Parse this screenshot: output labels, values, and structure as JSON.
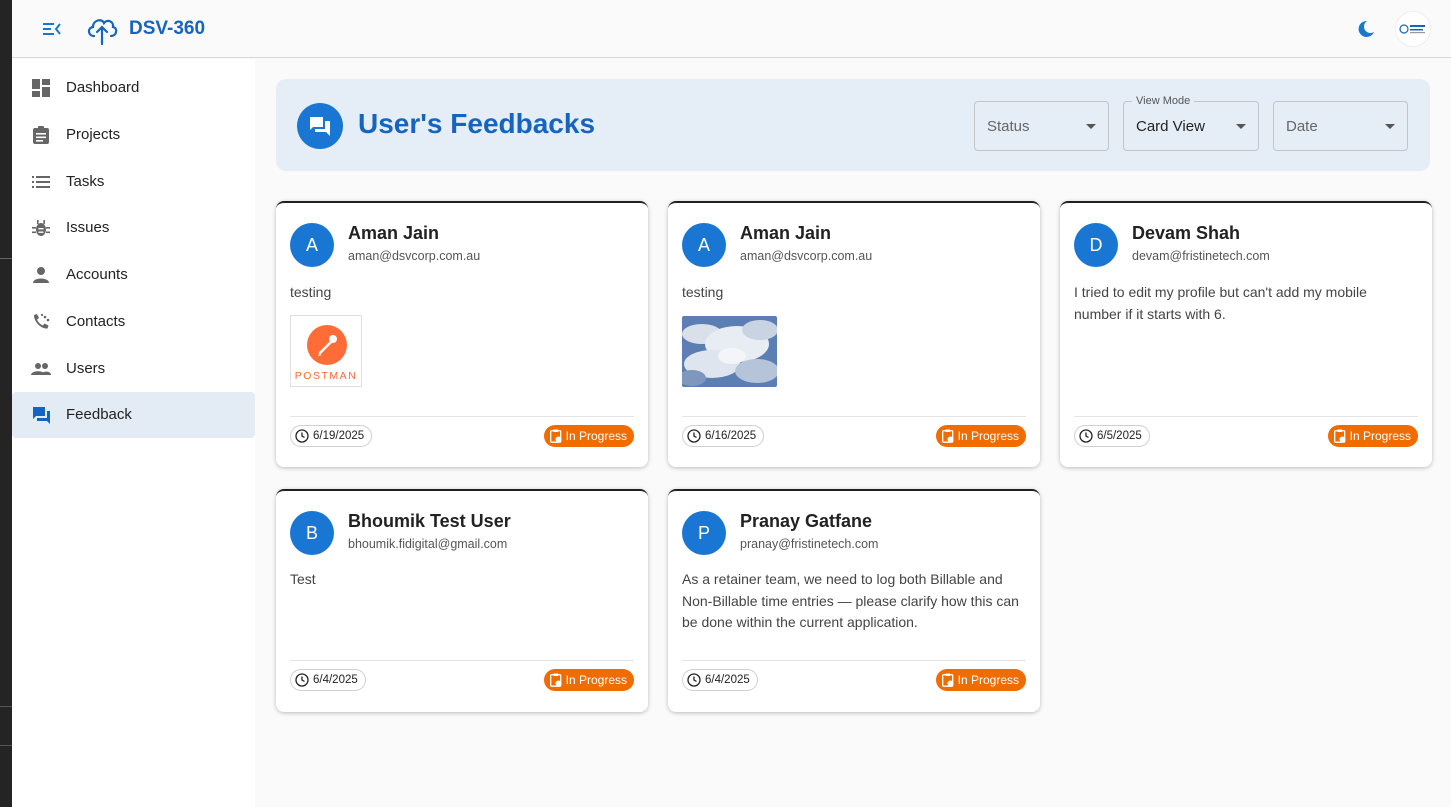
{
  "app": {
    "title": "DSV-360"
  },
  "sidebar": {
    "items": [
      {
        "label": "Dashboard",
        "icon": "dashboard-icon",
        "active": false
      },
      {
        "label": "Projects",
        "icon": "clipboard-icon",
        "active": false
      },
      {
        "label": "Tasks",
        "icon": "list-icon",
        "active": false
      },
      {
        "label": "Issues",
        "icon": "bug-icon",
        "active": false
      },
      {
        "label": "Accounts",
        "icon": "person-icon",
        "active": false
      },
      {
        "label": "Contacts",
        "icon": "contacts-icon",
        "active": false
      },
      {
        "label": "Users",
        "icon": "people-icon",
        "active": false
      },
      {
        "label": "Feedback",
        "icon": "feedback-icon",
        "active": true
      }
    ]
  },
  "header": {
    "title": "User's Feedbacks",
    "filters": {
      "status": {
        "placeholder": "Status"
      },
      "view_mode": {
        "label": "View Mode",
        "value": "Card View"
      },
      "date": {
        "placeholder": "Date"
      }
    }
  },
  "colors": {
    "accent": "#1976d2",
    "title_blue": "#1565c0",
    "status_in_progress": "#ef6c00",
    "header_bg": "#e5edf7"
  },
  "cards": [
    {
      "initial": "A",
      "name": "Aman Jain",
      "email": "aman@dsvcorp.com.au",
      "message": "testing",
      "attachment": "postman-logo",
      "attachment_text": "POSTMAN",
      "date": "6/19/2025",
      "status": "In Progress"
    },
    {
      "initial": "A",
      "name": "Aman Jain",
      "email": "aman@dsvcorp.com.au",
      "message": "testing",
      "attachment": "sky-photo",
      "date": "6/16/2025",
      "status": "In Progress"
    },
    {
      "initial": "D",
      "name": "Devam Shah",
      "email": "devam@fristinetech.com",
      "message": "I tried to edit my profile but can't add my mobile number if it starts with 6.",
      "date": "6/5/2025",
      "status": "In Progress"
    },
    {
      "initial": "B",
      "name": "Bhoumik Test User",
      "email": "bhoumik.fidigital@gmail.com",
      "message": "Test",
      "date": "6/4/2025",
      "status": "In Progress"
    },
    {
      "initial": "P",
      "name": "Pranay Gatfane",
      "email": "pranay@fristinetech.com",
      "message": "As a retainer team, we need to log both Billable and Non-Billable time entries — please clarify how this can be done within the current application.",
      "date": "6/4/2025",
      "status": "In Progress"
    }
  ]
}
